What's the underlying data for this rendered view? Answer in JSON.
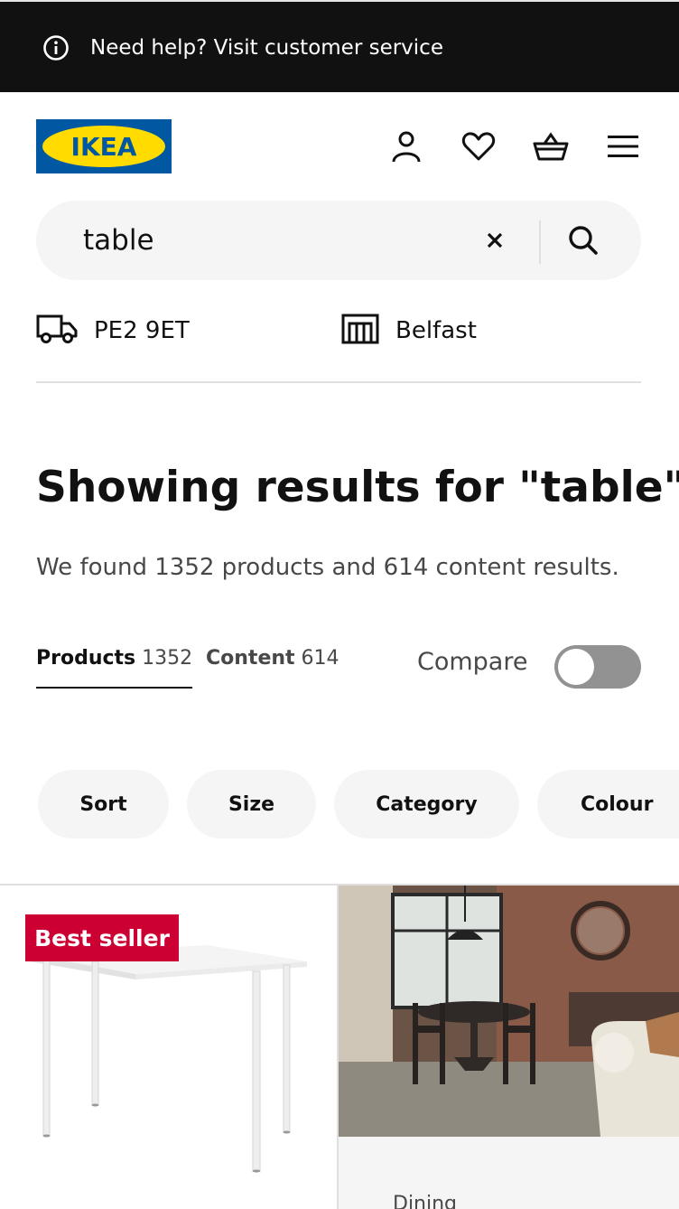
{
  "topbar": {
    "help_text": "Need help? Visit customer service",
    "icon": "info-icon",
    "background": "#111111"
  },
  "brand": {
    "logo_text": "IKEA",
    "colors": {
      "blue": "#0058a3",
      "yellow": "#ffdb00"
    }
  },
  "header_icons": [
    "profile-icon",
    "heart-icon",
    "basket-icon",
    "menu-icon"
  ],
  "search": {
    "value": "table",
    "clear_icon": "close-icon",
    "search_icon": "search-icon"
  },
  "location": {
    "postcode": "PE2 9ET",
    "store": "Belfast",
    "postcode_icon": "delivery-truck-icon",
    "store_icon": "store-icon"
  },
  "results": {
    "headline_prefix": "Showing results for \"",
    "query": "table",
    "headline_suffix": "\"",
    "summary": "We found 1352 products and 614 content results."
  },
  "tabs": [
    {
      "label": "Products",
      "count": "1352",
      "active": true
    },
    {
      "label": "Content",
      "count": "614",
      "active": false
    }
  ],
  "compare": {
    "label": "Compare",
    "enabled": false
  },
  "filters": [
    "Sort",
    "Size",
    "Category",
    "Colour"
  ],
  "products": [
    {
      "badge": "Best seller",
      "badge_color": "#cc0033",
      "image": "white-table-image"
    },
    {
      "category": "Dining",
      "image": "dining-room-image"
    }
  ]
}
